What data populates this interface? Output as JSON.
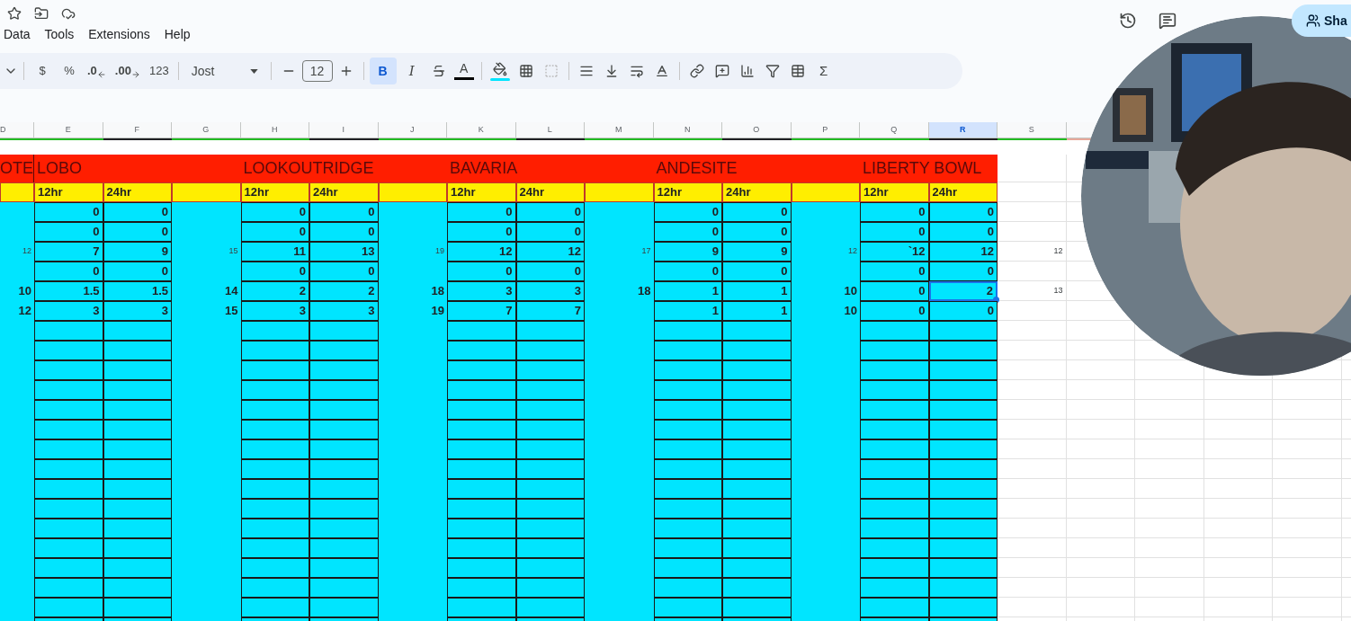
{
  "menu": [
    "Data",
    "Tools",
    "Extensions",
    "Help"
  ],
  "share": {
    "label": "Sha"
  },
  "toolbar": {
    "currency": "$",
    "percent": "%",
    "decrease_decimals": ".0",
    "increase_decimals": ".00",
    "more_formats": "123",
    "font": "Jost",
    "font_size": "12",
    "bold": {
      "label": "B",
      "selected": true
    },
    "italic": {
      "label": "I",
      "selected": false
    },
    "text_color": "A",
    "sum": "Σ"
  },
  "sheet": {
    "columns": [
      {
        "letter": "D",
        "selected": false
      },
      {
        "letter": "E",
        "selected": false
      },
      {
        "letter": "F",
        "selected": false
      },
      {
        "letter": "G",
        "selected": false
      },
      {
        "letter": "H",
        "selected": false
      },
      {
        "letter": "I",
        "selected": false
      },
      {
        "letter": "J",
        "selected": false
      },
      {
        "letter": "K",
        "selected": false
      },
      {
        "letter": "L",
        "selected": false
      },
      {
        "letter": "M",
        "selected": false
      },
      {
        "letter": "N",
        "selected": false
      },
      {
        "letter": "O",
        "selected": false
      },
      {
        "letter": "P",
        "selected": false
      },
      {
        "letter": "Q",
        "selected": false
      },
      {
        "letter": "R",
        "selected": true
      },
      {
        "letter": "S",
        "selected": false
      }
    ],
    "leading_title": "OTE",
    "blocks": [
      {
        "title": "LOBO",
        "headers": [
          "12hr",
          "24hr"
        ],
        "rows": [
          {
            "cells": [
              {
                "text": "0",
                "selected": false
              },
              {
                "text": "0",
                "selected": false
              }
            ]
          },
          {
            "cells": [
              {
                "text": "0",
                "selected": false
              },
              {
                "text": "0",
                "selected": false
              }
            ]
          },
          {
            "note": "12",
            "cells": [
              {
                "text": "7",
                "selected": false
              },
              {
                "text": "9",
                "selected": false
              }
            ]
          },
          {
            "cells": [
              {
                "text": "0",
                "selected": false
              },
              {
                "text": "0",
                "selected": false
              }
            ]
          },
          {
            "side": "10",
            "cells": [
              {
                "text": "1.5",
                "selected": false
              },
              {
                "text": "1.5",
                "selected": false
              }
            ]
          },
          {
            "side": "12",
            "cells": [
              {
                "text": "3",
                "selected": false
              },
              {
                "text": "3",
                "selected": false
              }
            ]
          }
        ]
      },
      {
        "title": "LOOKOUTRIDGE",
        "headers": [
          "12hr",
          "24hr"
        ],
        "rows": [
          {
            "cells": [
              {
                "text": "0",
                "selected": false
              },
              {
                "text": "0",
                "selected": false
              }
            ]
          },
          {
            "cells": [
              {
                "text": "0",
                "selected": false
              },
              {
                "text": "0",
                "selected": false
              }
            ]
          },
          {
            "note": "15",
            "cells": [
              {
                "text": "11",
                "selected": false
              },
              {
                "text": "13",
                "selected": false
              }
            ]
          },
          {
            "cells": [
              {
                "text": "0",
                "selected": false
              },
              {
                "text": "0",
                "selected": false
              }
            ]
          },
          {
            "side": "14",
            "cells": [
              {
                "text": "2",
                "selected": false
              },
              {
                "text": "2",
                "selected": false
              }
            ]
          },
          {
            "side": "15",
            "cells": [
              {
                "text": "3",
                "selected": false
              },
              {
                "text": "3",
                "selected": false
              }
            ]
          }
        ]
      },
      {
        "title": "BAVARIA",
        "headers": [
          "12hr",
          "24hr"
        ],
        "rows": [
          {
            "cells": [
              {
                "text": "0",
                "selected": false
              },
              {
                "text": "0",
                "selected": false
              }
            ]
          },
          {
            "cells": [
              {
                "text": "0",
                "selected": false
              },
              {
                "text": "0",
                "selected": false
              }
            ]
          },
          {
            "note": "19",
            "cells": [
              {
                "text": "12",
                "selected": false
              },
              {
                "text": "12",
                "selected": false
              }
            ]
          },
          {
            "cells": [
              {
                "text": "0",
                "selected": false
              },
              {
                "text": "0",
                "selected": false
              }
            ]
          },
          {
            "side": "18",
            "cells": [
              {
                "text": "3",
                "selected": false
              },
              {
                "text": "3",
                "selected": false
              }
            ]
          },
          {
            "side": "19",
            "cells": [
              {
                "text": "7",
                "selected": false
              },
              {
                "text": "7",
                "selected": false
              }
            ]
          }
        ]
      },
      {
        "title": "ANDESITE",
        "headers": [
          "12hr",
          "24hr"
        ],
        "rows": [
          {
            "cells": [
              {
                "text": "0",
                "selected": false
              },
              {
                "text": "0",
                "selected": false
              }
            ]
          },
          {
            "cells": [
              {
                "text": "0",
                "selected": false
              },
              {
                "text": "0",
                "selected": false
              }
            ]
          },
          {
            "note": "17",
            "cells": [
              {
                "text": "9",
                "selected": false
              },
              {
                "text": "9",
                "selected": false
              }
            ]
          },
          {
            "cells": [
              {
                "text": "0",
                "selected": false
              },
              {
                "text": "0",
                "selected": false
              }
            ]
          },
          {
            "side": "18",
            "cells": [
              {
                "text": "1",
                "selected": false
              },
              {
                "text": "1",
                "selected": false
              }
            ]
          },
          {
            "cells": [
              {
                "text": "1",
                "selected": false
              },
              {
                "text": "1",
                "selected": false
              }
            ]
          }
        ]
      },
      {
        "title": "LIBERTY BOWL",
        "headers": [
          "12hr",
          "24hr"
        ],
        "rows": [
          {
            "cells": [
              {
                "text": "0",
                "selected": false
              },
              {
                "text": "0",
                "selected": false
              }
            ]
          },
          {
            "cells": [
              {
                "text": "0",
                "selected": false
              },
              {
                "text": "0",
                "selected": false
              }
            ]
          },
          {
            "note": "12",
            "after": "12",
            "cells": [
              {
                "text": "`12",
                "selected": false
              },
              {
                "text": "12",
                "selected": false
              }
            ]
          },
          {
            "cells": [
              {
                "text": "0",
                "selected": false
              },
              {
                "text": "0",
                "selected": false
              }
            ]
          },
          {
            "side": "10",
            "after": "13",
            "cells": [
              {
                "text": "0",
                "selected": false
              },
              {
                "text": "2",
                "selected": true
              }
            ]
          },
          {
            "side": "10",
            "cells": [
              {
                "text": "0",
                "selected": false
              },
              {
                "text": "0",
                "selected": false
              }
            ]
          }
        ]
      }
    ]
  },
  "webcam": {
    "kind": "picture"
  }
}
